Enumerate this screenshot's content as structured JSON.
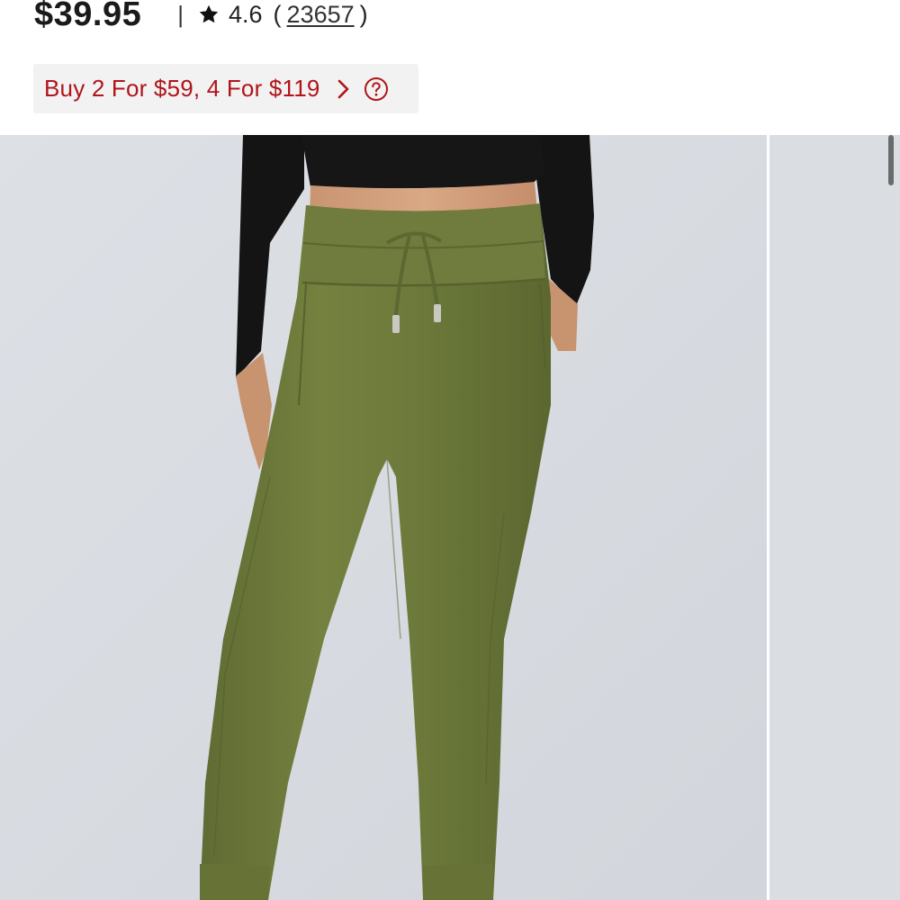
{
  "product": {
    "price": "$39.95",
    "divider": "|",
    "rating": "4.6",
    "review_open": "(",
    "review_count": "23657",
    "review_close": ")"
  },
  "promo": {
    "text": "Buy 2 For $59, 4 For $119"
  },
  "gallery": {
    "image_alt": "Model wearing olive green high-waisted joggers with drawstring waist and black long-sleeve crop top",
    "colors": {
      "background": "#d7dbe0",
      "pants": "#6f7c3e",
      "top": "#111111"
    }
  },
  "icons": {
    "star": "star-icon",
    "chevron": "chevron-right-icon",
    "help": "help-circle-icon"
  },
  "colors": {
    "promo_text": "#b0151b",
    "promo_bg": "#f2f2f2"
  }
}
